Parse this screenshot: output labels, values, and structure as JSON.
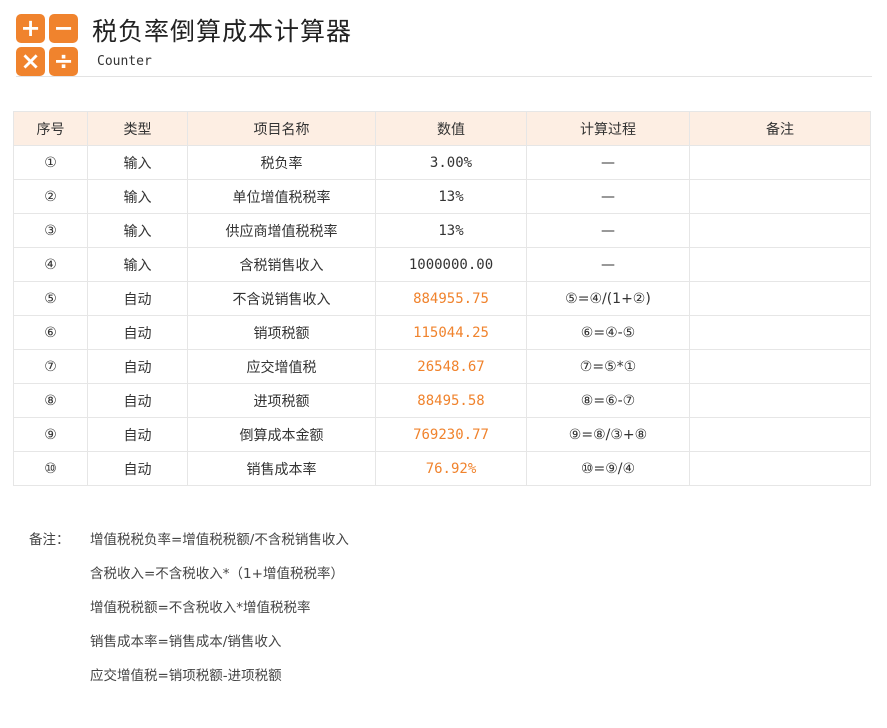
{
  "app": {
    "title": "税负率倒算成本计算器",
    "subtitle": "Counter",
    "logo_symbols": [
      "+",
      "−",
      "×",
      "÷"
    ],
    "accent_color": "#f0832d"
  },
  "table": {
    "headers": [
      "序号",
      "类型",
      "项目名称",
      "数值",
      "计算过程",
      "备注"
    ],
    "rows": [
      {
        "seq": "①",
        "type": "输入",
        "name": "税负率",
        "value": "3.00%",
        "process": "—",
        "remark": ""
      },
      {
        "seq": "②",
        "type": "输入",
        "name": "单位增值税税率",
        "value": "13%",
        "process": "—",
        "remark": ""
      },
      {
        "seq": "③",
        "type": "输入",
        "name": "供应商增值税税率",
        "value": "13%",
        "process": "—",
        "remark": ""
      },
      {
        "seq": "④",
        "type": "输入",
        "name": "含税销售收入",
        "value": "1000000.00",
        "process": "—",
        "remark": ""
      },
      {
        "seq": "⑤",
        "type": "自动",
        "name": "不含说销售收入",
        "value": "884955.75",
        "process": "⑤=④/(1+②)",
        "remark": ""
      },
      {
        "seq": "⑥",
        "type": "自动",
        "name": "销项税额",
        "value": "115044.25",
        "process": "⑥=④-⑤",
        "remark": ""
      },
      {
        "seq": "⑦",
        "type": "自动",
        "name": "应交增值税",
        "value": "26548.67",
        "process": "⑦=⑤*①",
        "remark": ""
      },
      {
        "seq": "⑧",
        "type": "自动",
        "name": "进项税额",
        "value": "88495.58",
        "process": "⑧=⑥-⑦",
        "remark": ""
      },
      {
        "seq": "⑨",
        "type": "自动",
        "name": "倒算成本金额",
        "value": "769230.77",
        "process": "⑨=⑧/③+⑧",
        "remark": ""
      },
      {
        "seq": "⑩",
        "type": "自动",
        "name": "销售成本率",
        "value": "76.92%",
        "process": "⑩=⑨/④",
        "remark": ""
      }
    ]
  },
  "notes": {
    "label": "备注：",
    "lines": [
      "增值税税负率=增值税税额/不含税销售收入",
      "含税收入=不含税收入*（1+增值税税率）",
      "增值税税额=不含税收入*增值税税率",
      "销售成本率=销售成本/销售收入",
      "应交增值税=销项税额-进项税额"
    ]
  }
}
